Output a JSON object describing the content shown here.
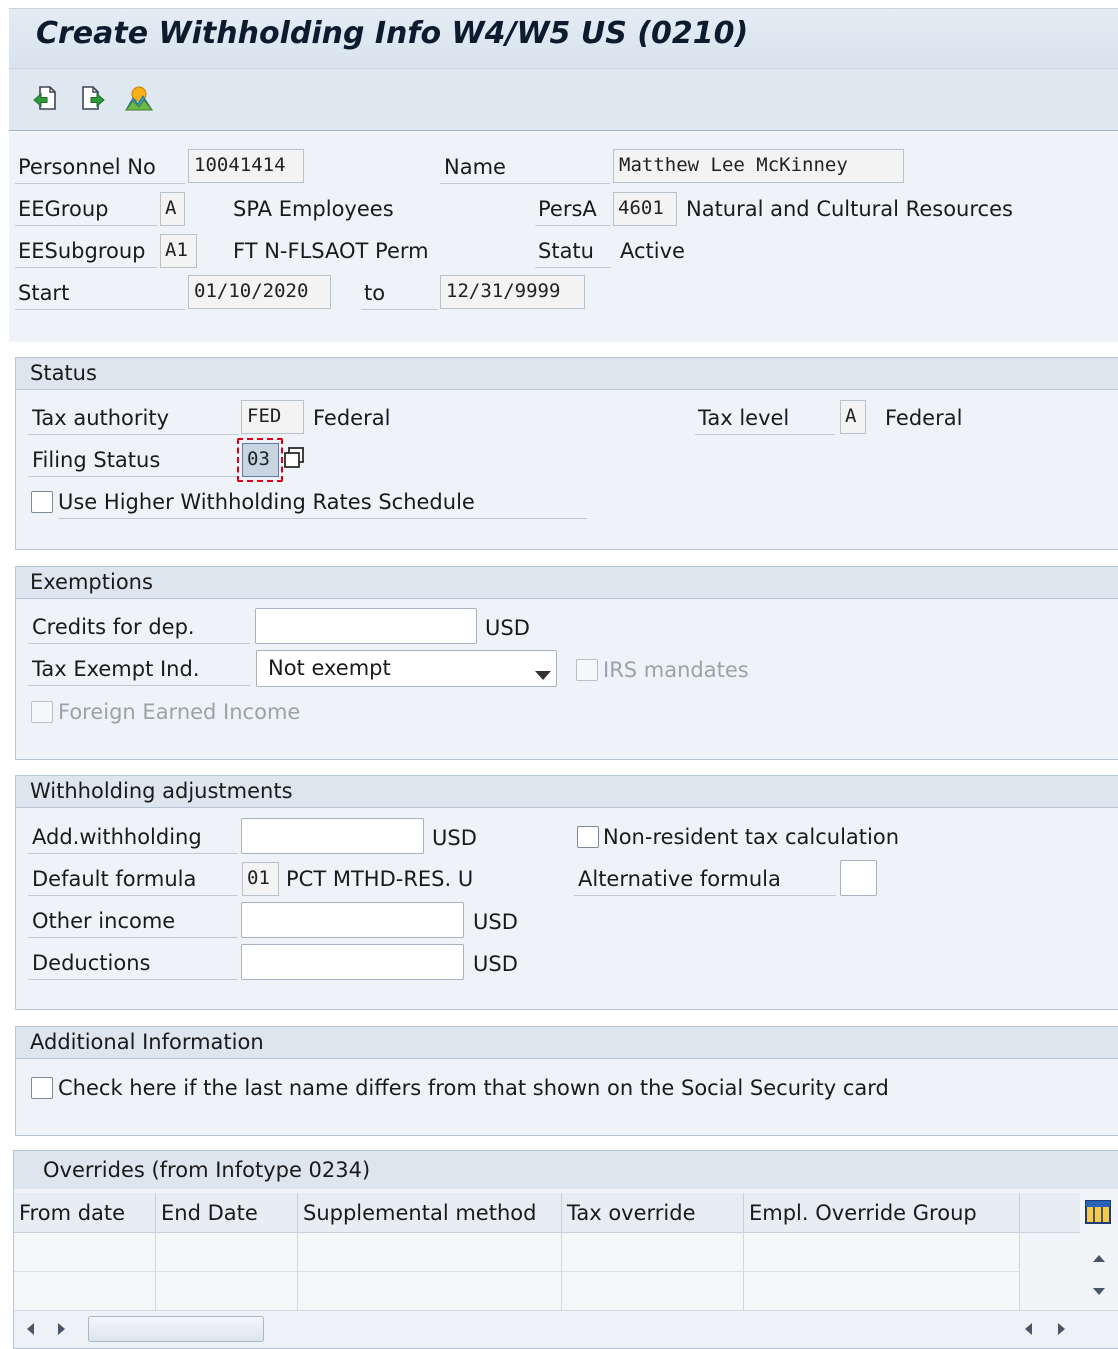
{
  "window": {
    "title": "Create Withholding Info W4/W5 US (0210)"
  },
  "toolbar": {
    "buttons": [
      {
        "icon": "previous-record-icon"
      },
      {
        "icon": "next-record-icon"
      },
      {
        "icon": "overview-icon"
      }
    ]
  },
  "header": {
    "personnel_no_label": "Personnel No",
    "personnel_no": "10041414",
    "name_label": "Name",
    "name": "Matthew Lee McKinney",
    "eegroup_label": "EEGroup",
    "eegroup_code": "A",
    "eegroup_text": "SPA Employees",
    "persa_label": "PersA",
    "persa_code": "4601",
    "persa_text": "Natural and Cultural Resources",
    "eesubgroup_label": "EESubgroup",
    "eesubgroup_code": "A1",
    "eesubgroup_text": "FT N-FLSAOT Perm",
    "status_label": "Statu",
    "status_text": "Active",
    "start_label": "Start",
    "start_date": "01/10/2020",
    "to_label": "to",
    "end_date": "12/31/9999"
  },
  "status_group": {
    "title": "Status",
    "tax_authority_label": "Tax authority",
    "tax_authority_code": "FED",
    "tax_authority_text": "Federal",
    "tax_level_label": "Tax level",
    "tax_level_code": "A",
    "tax_level_text": "Federal",
    "filing_status_label": "Filing Status",
    "filing_status_value": "03",
    "higher_withholding_label": "Use Higher Withholding Rates Schedule",
    "higher_withholding_checked": false
  },
  "exemptions_group": {
    "title": "Exemptions",
    "credits_label": "Credits for dep.",
    "credits_value": "",
    "credits_currency": "USD",
    "tax_exempt_label": "Tax Exempt Ind.",
    "tax_exempt_value": "Not exempt",
    "irs_mandates_label": "IRS mandates",
    "foreign_earned_label": "Foreign Earned Income"
  },
  "withholding_group": {
    "title": "Withholding adjustments",
    "add_withholding_label": "Add.withholding",
    "add_withholding_value": "",
    "add_withholding_currency": "USD",
    "non_resident_label": "Non-resident tax calculation",
    "default_formula_label": "Default formula",
    "default_formula_code": "01",
    "default_formula_text": "PCT MTHD-RES. U",
    "alternative_formula_label": "Alternative formula",
    "alternative_formula_value": "",
    "other_income_label": "Other income",
    "other_income_value": "",
    "other_income_currency": "USD",
    "deductions_label": "Deductions",
    "deductions_value": "",
    "deductions_currency": "USD"
  },
  "additional_group": {
    "title": "Additional Information",
    "last_name_differs_label": "Check here if the last name differs from that shown on the Social Security card"
  },
  "overrides_table": {
    "title": "Overrides (from Infotype 0234)",
    "columns": [
      "From date",
      "End Date",
      "Supplemental method",
      "Tax override",
      "Empl. Override Group"
    ],
    "rows": [
      [
        "",
        "",
        "",
        "",
        ""
      ],
      [
        "",
        "",
        "",
        "",
        ""
      ]
    ]
  },
  "colors": {
    "title_bg": "#dfe8f1",
    "group_header_bg": "#dde6ef",
    "focus_border": "#d9001b"
  }
}
